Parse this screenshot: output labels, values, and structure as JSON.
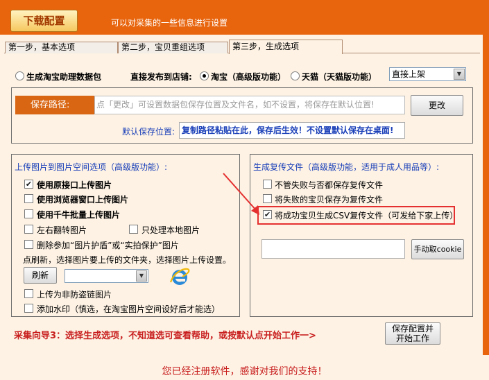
{
  "header": {
    "title_button": "下载配置",
    "description": "可以对采集的一些信息进行设置"
  },
  "tabs": [
    {
      "label": "第一步，基本选项",
      "active": false
    },
    {
      "label": "第二步，宝贝重组选项",
      "active": false
    },
    {
      "label": "第三步，生成选项",
      "active": true
    }
  ],
  "top_row": {
    "radio_package": "生成淘宝助理数据包",
    "publish_label": "直接发布到店铺:",
    "radio_taobao": "淘宝（高级版功能）",
    "radio_tmall": "天猫（天猫版功能）",
    "publish_select": "直接上架"
  },
  "save_path": {
    "label": "保存路径:",
    "placeholder": "点「更改」可设置数据包保存位置及文件名，如不设置，将保存在默认位置!",
    "change_button": "更改",
    "default_label": "默认保存位置:",
    "default_hint": "复制路径粘贴在此，保存后生效！不设置默认保存在桌面!"
  },
  "upload_panel": {
    "title": "上传图片到图片空间选项（高级版功能）:",
    "options": [
      {
        "label": "使用原接口上传图片",
        "checked": true
      },
      {
        "label": "使用浏览器窗口上传图片",
        "checked": false
      },
      {
        "label": "使用千牛批量上传图片",
        "checked": false
      }
    ],
    "flip_label": "左右翻转图片",
    "local_only_label": "只处理本地图片",
    "delete_label": "删除参加“图片护盾”或“实拍保护”图片",
    "refresh_hint": "点刷新，选择图片要上传的文件夹，选择图片上传设置。",
    "refresh_button": "刷新",
    "anti_hotlink_label": "上传为非防盗链图片",
    "watermark_label": "添加水印（慎选，在淘宝图片空间设好后才能选）"
  },
  "dup_panel": {
    "title": "生成复传文件（高级版功能，适用于成人用品等）:",
    "opt1": "不管失败与否都保存复传文件",
    "opt2": "将失败的宝贝保存为复传文件",
    "opt3": "将成功宝贝生成CSV复传文件（可发给下家上传）",
    "opt3_checked": true,
    "cookie_button": "手动取cookie"
  },
  "guide_text": "采集向导3：选择生成选项，不知道选可查看帮助，或按默认点开始工作一>",
  "save_start_button": "保存配置并开始工作",
  "footer_text": "您已经注册软件，感谢对我们的支持！",
  "colors": {
    "header_bg": "#e8650e",
    "content_bg": "#fdf2e4",
    "accent_red": "#c81e1e",
    "accent_blue": "#1a3fb8",
    "highlight_red": "#e53030"
  }
}
